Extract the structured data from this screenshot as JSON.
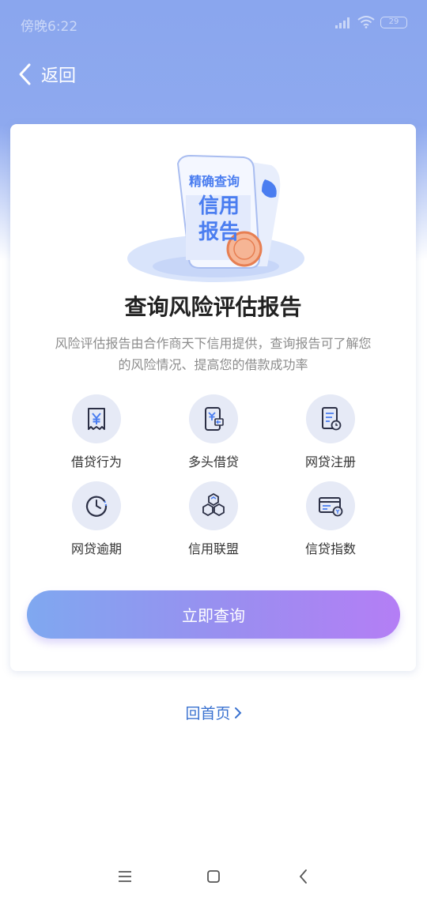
{
  "status_bar": {
    "time": "傍晚6:22",
    "battery": "29"
  },
  "nav": {
    "back_label": "返回"
  },
  "card": {
    "badge_top": "精确查询",
    "badge_main_1": "信用",
    "badge_main_2": "报告",
    "title": "查询风险评估报告",
    "description": "风险评估报告由合作商天下信用提供，查询报告可了解您的风险情况、提高您的借款成功率",
    "features": [
      {
        "label": "借贷行为",
        "icon": "receipt-yen-icon"
      },
      {
        "label": "多头借贷",
        "icon": "phone-yen-icon"
      },
      {
        "label": "网贷注册",
        "icon": "document-clock-icon"
      },
      {
        "label": "网贷逾期",
        "icon": "clock-icon"
      },
      {
        "label": "信用联盟",
        "icon": "hexagons-icon"
      },
      {
        "label": "信贷指数",
        "icon": "card-coin-icon"
      }
    ],
    "query_button": "立即查询"
  },
  "home_link": "回首页",
  "colors": {
    "header": "#8aa6ee",
    "link": "#3a72d0",
    "icon_stroke": "#2b2f45",
    "icon_accent": "#4a7df0"
  }
}
